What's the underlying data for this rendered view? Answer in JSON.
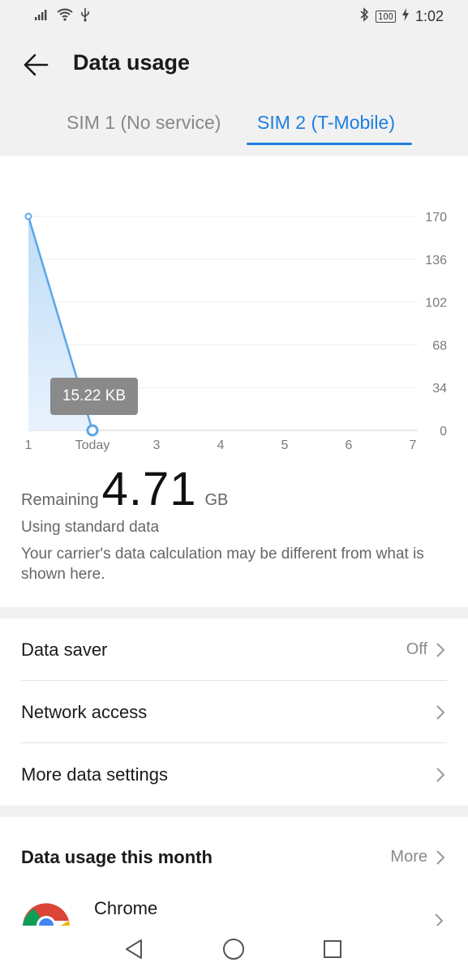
{
  "status_bar": {
    "battery": "100",
    "time": "1:02"
  },
  "header": {
    "title": "Data usage",
    "tabs": [
      {
        "label": "SIM 1 (No service)",
        "selected": false
      },
      {
        "label": "SIM 2 (T-Mobile)",
        "selected": true
      }
    ]
  },
  "chart_data": {
    "type": "area",
    "x_labels": [
      "1",
      "Today",
      "3",
      "4",
      "5",
      "6",
      "7"
    ],
    "y_ticks": [
      "170",
      "136",
      "102",
      "68",
      "34",
      "0"
    ],
    "ylim": [
      0,
      170
    ],
    "series": [
      {
        "x_index": [
          0,
          1
        ],
        "values": [
          170,
          0
        ]
      }
    ],
    "tooltip": "15.22 KB",
    "grid": true,
    "color": "#5aa6e8"
  },
  "summary": {
    "remaining_label": "Remaining",
    "remaining_value": "4.71",
    "remaining_unit": "GB",
    "plan_text": "Using standard data",
    "note": "Your carrier's data calculation may be different from what is shown here."
  },
  "settings": {
    "data_saver_label": "Data saver",
    "data_saver_value": "Off",
    "network_access_label": "Network access",
    "more_settings_label": "More data settings"
  },
  "monthly": {
    "title": "Data usage this month",
    "more_label": "More",
    "apps": [
      {
        "name": "Chrome",
        "icon": "chrome-icon"
      }
    ]
  },
  "colors": {
    "accent": "#1f7ee0",
    "background_gray": "#f1f1f1"
  }
}
